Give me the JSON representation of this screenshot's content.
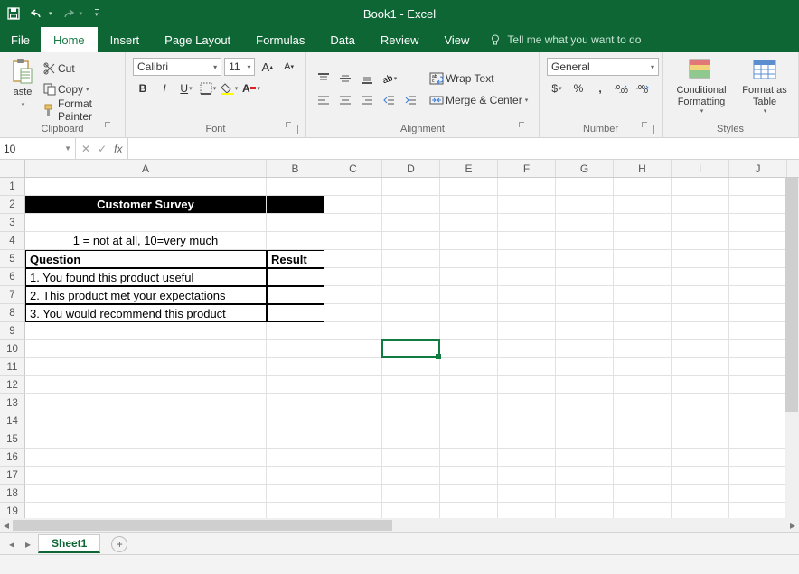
{
  "titlebar": {
    "doc_title": "Book1  -  Excel"
  },
  "tabs": {
    "file": "File",
    "home": "Home",
    "insert": "Insert",
    "page_layout": "Page Layout",
    "formulas": "Formulas",
    "data": "Data",
    "review": "Review",
    "view": "View",
    "tellme": "Tell me what you want to do"
  },
  "ribbon": {
    "clipboard": {
      "label": "Clipboard",
      "cut": "Cut",
      "copy": "Copy",
      "format_painter": "Format Painter"
    },
    "font": {
      "label": "Font",
      "name": "Calibri",
      "size": "11"
    },
    "alignment": {
      "label": "Alignment",
      "wrap": "Wrap Text",
      "merge": "Merge & Center"
    },
    "number": {
      "label": "Number",
      "format": "General"
    },
    "styles": {
      "label": "Styles",
      "cond": "Conditional Formatting",
      "table": "Format as Table"
    }
  },
  "formula_bar": {
    "name_box": "10",
    "formula": ""
  },
  "sheet": {
    "columns": [
      "A",
      "B",
      "C",
      "D",
      "E",
      "F",
      "G",
      "H",
      "I",
      "J"
    ],
    "title": "Customer Survey",
    "scale_note": "1 = not at all, 10=very much",
    "header_q": "Question",
    "header_r": "Result",
    "rows": [
      {
        "q": "1. You found this product useful",
        "r": ""
      },
      {
        "q": "2. This product met your expectations",
        "r": ""
      },
      {
        "q": "3. You would recommend this product",
        "r": ""
      }
    ],
    "row_labels": [
      "1",
      "2",
      "3",
      "4",
      "5",
      "6",
      "7",
      "8",
      "9",
      "10",
      "11",
      "12",
      "13",
      "14",
      "15",
      "16",
      "17",
      "18",
      "19"
    ]
  },
  "sheettabs": {
    "active": "Sheet1"
  }
}
